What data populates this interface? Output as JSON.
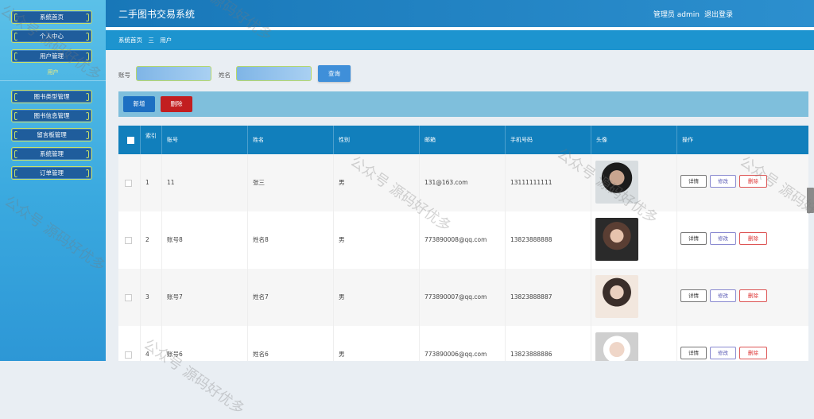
{
  "sidebar": {
    "items": [
      {
        "label": "系统首页"
      },
      {
        "label": "个人中心"
      },
      {
        "label": "用户管理"
      },
      {
        "label": "图书类型管理"
      },
      {
        "label": "图书信息管理"
      },
      {
        "label": "留言板管理"
      },
      {
        "label": "系统管理"
      },
      {
        "label": "订单管理"
      }
    ],
    "sub_item": "用户"
  },
  "header": {
    "title": "二手图书交易系统",
    "user": "管理员 admin",
    "logout": "退出登录"
  },
  "breadcrumb": {
    "home": "系统首页",
    "separator": "三",
    "current": "用户"
  },
  "search": {
    "account_label": "账号",
    "name_label": "姓名",
    "query_button": "查询"
  },
  "actions": {
    "add": "新增",
    "delete": "删除"
  },
  "table": {
    "columns": [
      "索引",
      "账号",
      "姓名",
      "性别",
      "邮箱",
      "手机号码",
      "头像",
      "操作"
    ],
    "rows": [
      {
        "index": "1",
        "account": "11",
        "name": "张三",
        "gender": "男",
        "email": "131@163.com",
        "phone": "13111111111"
      },
      {
        "index": "2",
        "account": "账号8",
        "name": "姓名8",
        "gender": "男",
        "email": "773890008@qq.com",
        "phone": "13823888888"
      },
      {
        "index": "3",
        "account": "账号7",
        "name": "姓名7",
        "gender": "男",
        "email": "773890007@qq.com",
        "phone": "13823888887"
      },
      {
        "index": "4",
        "account": "账号6",
        "name": "姓名6",
        "gender": "男",
        "email": "773890006@qq.com",
        "phone": "13823888886"
      }
    ],
    "op_labels": {
      "detail": "详情",
      "edit": "修改",
      "delete": "删除"
    }
  },
  "watermark": "公众号 源码好优多"
}
